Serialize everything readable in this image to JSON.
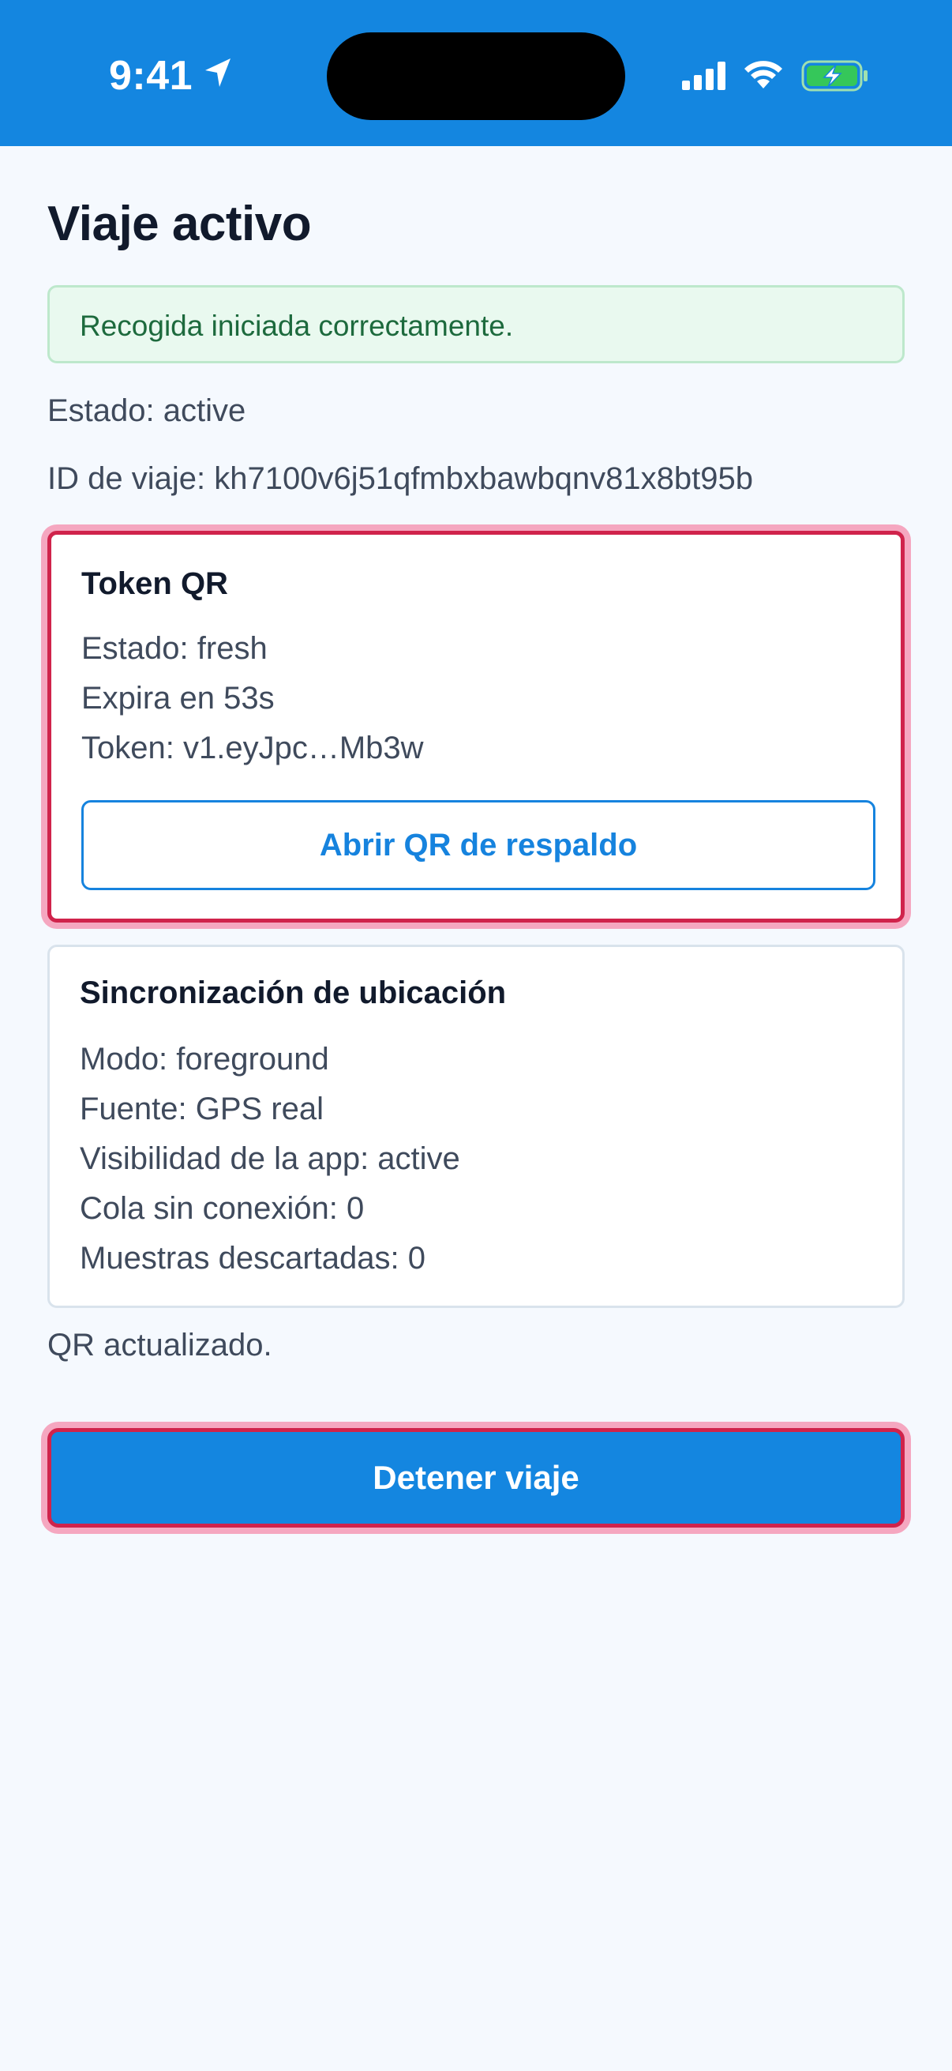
{
  "status_bar": {
    "time": "9:41",
    "icons": [
      "location-arrow-icon",
      "signal-icon",
      "wifi-icon",
      "battery-charging-icon"
    ],
    "color": "#1486e0"
  },
  "page": {
    "title": "Viaje activo"
  },
  "banner": {
    "message": "Recogida iniciada correctamente."
  },
  "trip": {
    "status": "Estado: active",
    "id": "ID de viaje: kh7100v6j51qfmbxbawbqnv81x8bt95b"
  },
  "qr_card": {
    "title": "Token QR",
    "lines": [
      "Estado: fresh",
      "Expira en 53s",
      "Token: v1.eyJpc…Mb3w"
    ],
    "button_label": "Abrir QR de respaldo"
  },
  "location_card": {
    "title": "Sincronización de ubicación",
    "lines": [
      "Modo: foreground",
      "Fuente: GPS real",
      "Visibilidad de la app: active",
      "Cola sin conexión: 0",
      "Muestras descartadas: 0"
    ]
  },
  "footer": {
    "message": "QR actualizado."
  },
  "actions": {
    "stop_label": "Detener viaje"
  },
  "colors": {
    "primary": "#1486e0",
    "highlight": "#d0234b",
    "success_bg": "#e9f9ef",
    "success_text": "#1d6a3d"
  }
}
